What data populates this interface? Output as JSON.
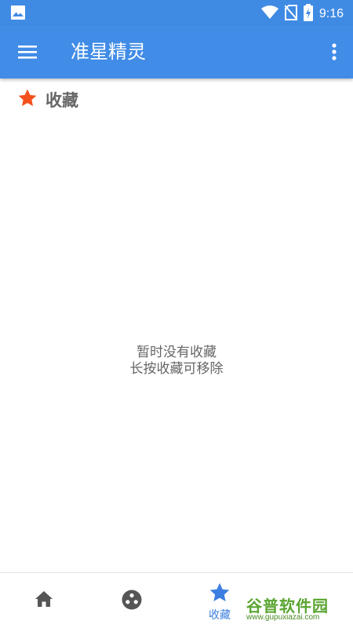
{
  "status_bar": {
    "time": "9:16",
    "icons": [
      "image-icon",
      "wifi-icon",
      "no-sim-icon",
      "battery-charging-icon"
    ]
  },
  "app_bar": {
    "title": "准星精灵",
    "menu_icon": "hamburger-menu-icon",
    "more_icon": "more-vert-icon",
    "color": "#418ce7"
  },
  "section": {
    "title": "收藏",
    "icon": "star-icon",
    "icon_color": "#f4511e"
  },
  "empty_state": {
    "line1": "暂时没有收藏",
    "line2": "长按收藏可移除"
  },
  "bottom_nav": {
    "items": [
      {
        "icon": "home-icon",
        "label": "",
        "active": false
      },
      {
        "icon": "discover-icon",
        "label": "",
        "active": false
      },
      {
        "icon": "star-icon",
        "label": "收藏",
        "active": true
      },
      {
        "icon": "more-icon",
        "label": "",
        "active": false
      }
    ],
    "active_color": "#3d7fe0",
    "inactive_color": "#555555"
  },
  "watermark": {
    "main": "谷普软件园",
    "url": "www.gupuxiazai.com"
  }
}
